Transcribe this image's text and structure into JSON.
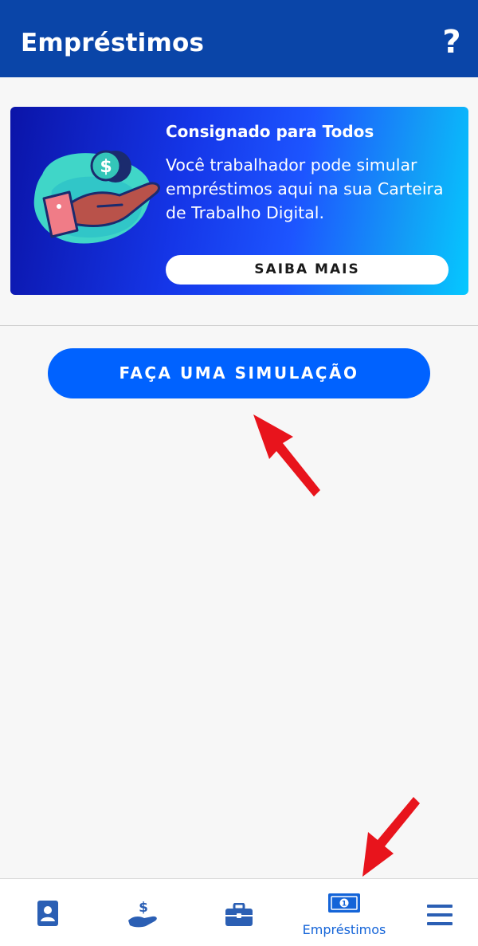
{
  "header": {
    "title": "Empréstimos",
    "help_icon": "help-question-icon",
    "help_label": "?"
  },
  "banner": {
    "title": "Consignado para Todos",
    "body": "Você trabalhador pode simular empréstimos aqui na sua Carteira de Trabalho Digital.",
    "button_label": "SAIBA MAIS",
    "illustration_icon": "hand-with-coin-icon"
  },
  "main": {
    "simulation_button_label": "FAÇA UMA SIMULAÇÃO"
  },
  "bottom_nav": {
    "items": [
      {
        "icon": "id-card-icon",
        "label": ""
      },
      {
        "icon": "hand-dollar-icon",
        "label": ""
      },
      {
        "icon": "briefcase-icon",
        "label": ""
      },
      {
        "icon": "banknote-icon",
        "label": "Empréstimos",
        "active": true
      },
      {
        "icon": "menu-icon",
        "label": ""
      }
    ]
  },
  "colors": {
    "app_bar": "#0a45a8",
    "primary_button": "#0062ff",
    "nav_icon": "#2b5fb4",
    "nav_active": "#1464d8",
    "annotation_arrow": "#e8141c"
  }
}
